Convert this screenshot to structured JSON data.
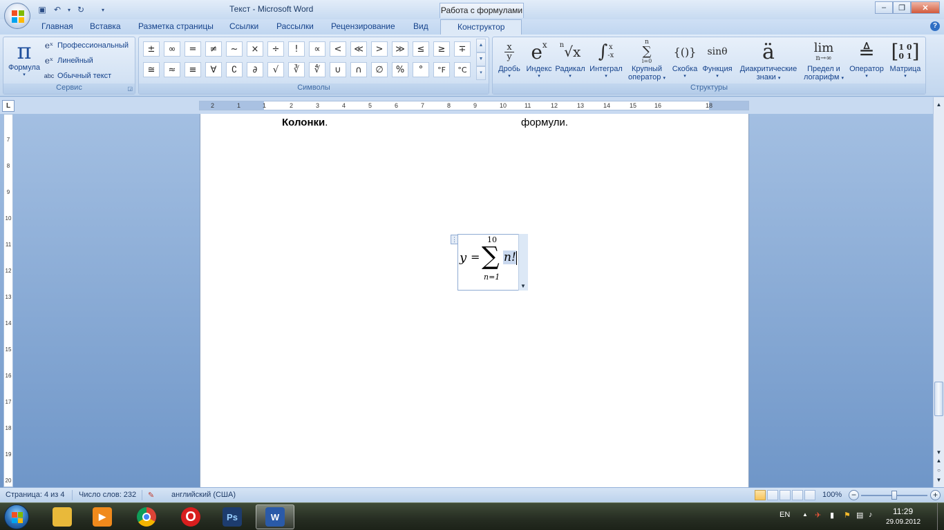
{
  "window": {
    "title": "Текст - Microsoft Word",
    "context_tab_group": "Работа с формулами"
  },
  "qat": {
    "save_icon": "save-icon",
    "undo_icon": "undo-icon",
    "redo_icon": "redo-icon"
  },
  "tabs": [
    {
      "label": "Главная"
    },
    {
      "label": "Вставка"
    },
    {
      "label": "Разметка страницы"
    },
    {
      "label": "Ссылки"
    },
    {
      "label": "Рассылки"
    },
    {
      "label": "Рецензирование"
    },
    {
      "label": "Вид"
    },
    {
      "label": "Конструктор"
    }
  ],
  "ribbon": {
    "service": {
      "group_label": "Сервис",
      "formula_label": "Формула",
      "professional": "Профессиональный",
      "linear": "Линейный",
      "plain_text": "Обычный текст",
      "plain_text_icon": "abc"
    },
    "symbols": {
      "group_label": "Символы",
      "row1": [
        "±",
        "∞",
        "=",
        "≠",
        "~",
        "×",
        "÷",
        "!",
        "∝",
        "<",
        "≪",
        ">",
        "≫",
        "≤",
        "≥",
        "∓"
      ],
      "row2": [
        "≅",
        "≈",
        "≡",
        "∀",
        "∁",
        "∂",
        "√",
        "∛",
        "∜",
        "∪",
        "∩",
        "∅",
        "%",
        "°",
        "°F",
        "°C"
      ]
    },
    "structures": {
      "group_label": "Структуры",
      "items": [
        {
          "label": "Дробь",
          "label2": ""
        },
        {
          "label": "Индекс",
          "label2": ""
        },
        {
          "label": "Радикал",
          "label2": ""
        },
        {
          "label": "Интеграл",
          "label2": ""
        },
        {
          "label": "Крупный",
          "label2": "оператор"
        },
        {
          "label": "Скобка",
          "label2": ""
        },
        {
          "label": "Функция",
          "label2": ""
        },
        {
          "label": "Диакритические",
          "label2": "знаки"
        },
        {
          "label": "Предел и",
          "label2": "логарифм"
        },
        {
          "label": "Оператор",
          "label2": ""
        },
        {
          "label": "Матрица",
          "label2": ""
        }
      ],
      "glyphs": {
        "fraction_num": "x",
        "fraction_den": "y",
        "index_base": "e",
        "index_sup": "x",
        "radical_index": "n",
        "radical_body": "√x",
        "integral": "∫",
        "integral_sup": "x",
        "integral_sub": "-x",
        "large_op": "∑",
        "large_op_sup": "n",
        "large_op_sub": "i=0",
        "bracket": "{()}",
        "function": "sinθ",
        "accent": "ä",
        "limit": "lim",
        "limit_sub": "n→∞",
        "operator": "≜",
        "matrix_r1": "1 0",
        "matrix_r2": "0 1"
      }
    }
  },
  "ruler": {
    "corner": "L",
    "h_numbers": [
      "2",
      "1",
      "1",
      "2",
      "3",
      "4",
      "5",
      "6",
      "7",
      "8",
      "9",
      "10",
      "11",
      "12",
      "13",
      "14",
      "15",
      "16",
      "18"
    ],
    "v_numbers": [
      "7",
      "8",
      "9",
      "10",
      "11",
      "12",
      "13",
      "14",
      "15",
      "16",
      "17",
      "18",
      "19",
      "20"
    ]
  },
  "document": {
    "text_left_bold": "Колонки",
    "text_left_tail": ".",
    "text_right": "формули.",
    "equation": {
      "lhs": "y",
      "eq": "=",
      "sum_symbol": "∑",
      "upper": "10",
      "lower": "n=1",
      "body": "n!"
    }
  },
  "statusbar": {
    "page": "Страница: 4 из 4",
    "words": "Число слов: 232",
    "language": "английский (США)",
    "zoom": "100%",
    "zoom_value": 1.0
  },
  "taskbar": {
    "lang": "EN",
    "time": "11:29",
    "date": "29.09.2012",
    "apps": [
      {
        "name": "explorer",
        "color": "#e9b93a"
      },
      {
        "name": "media-player",
        "color": "#f08a1c"
      },
      {
        "name": "chrome",
        "color": "#3e9e3a"
      },
      {
        "name": "opera",
        "color": "#d81e1e"
      },
      {
        "name": "photoshop",
        "label": "Ps",
        "color": "#1d3c6e"
      },
      {
        "name": "word",
        "label": "W",
        "color": "#2a5aa8"
      }
    ]
  }
}
